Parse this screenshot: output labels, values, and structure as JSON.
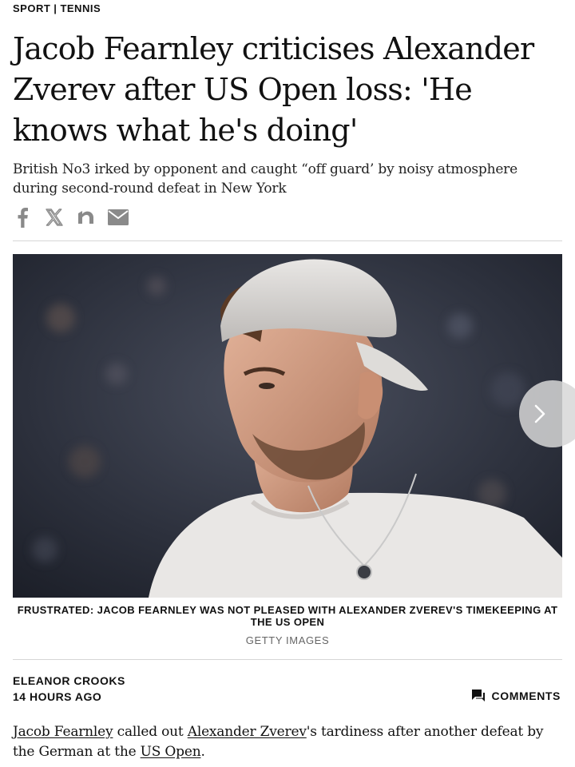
{
  "breadcrumb": {
    "section": "SPORT",
    "separator": "|",
    "subsection": "TENNIS"
  },
  "article": {
    "headline": "Jacob Fearnley criticises Alexander Zverev after US Open loss: 'He knows what he's doing'",
    "standfirst": "British No3 irked by opponent and caught “off guard’ by noisy atmosphere during second-round defeat in New York",
    "share_icons": [
      "facebook-icon",
      "x-icon",
      "flipboard-icon",
      "email-icon"
    ],
    "caption": "FRUSTRATED: JACOB FEARNLEY WAS NOT PLEASED WITH ALEXANDER ZVEREV'S TIMEKEEPING AT THE US OPEN",
    "credit": "GETTY IMAGES",
    "author": "ELEANOR CROOKS",
    "timestamp": "14 HOURS AGO",
    "comments_label": "COMMENTS",
    "body": {
      "link1": "Jacob Fearnley",
      "text1": " called out ",
      "link2": "Alexander Zverev",
      "text2": "'s tardiness after another defeat by the German at the ",
      "link3": "US Open",
      "text3": "."
    }
  },
  "colors": {
    "text": "#111111",
    "icon_grey": "#8a8a8a",
    "rule": "#d6d6d6",
    "credit": "#666666"
  }
}
